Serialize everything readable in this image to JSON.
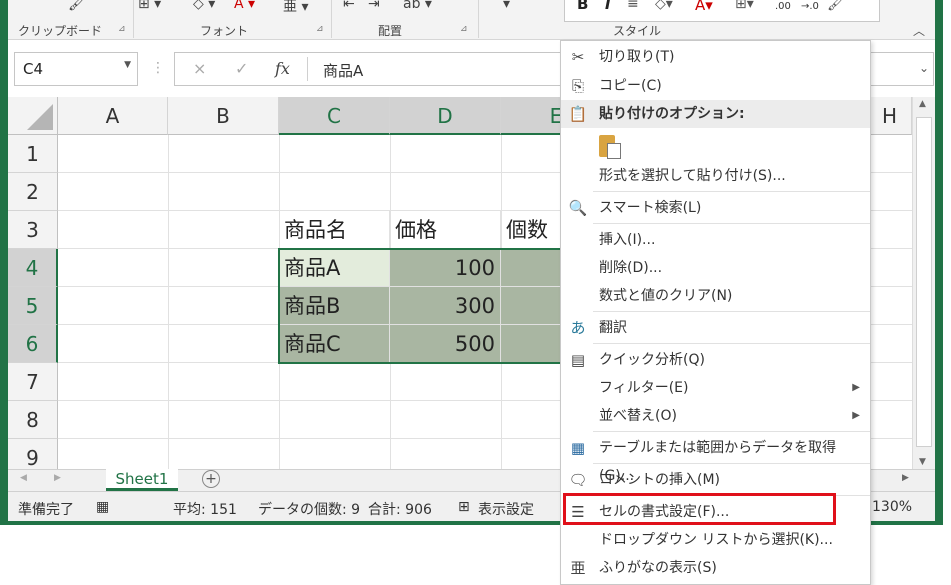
{
  "ribbon": {
    "groups": [
      "クリップボード",
      "フォント",
      "配置",
      "スタイル"
    ]
  },
  "formula_bar": {
    "name_box": "C4",
    "fx_label": "fx",
    "cancel_icon": "×",
    "confirm_icon": "✓",
    "value": "商品A"
  },
  "columns": [
    "A",
    "B",
    "C",
    "D",
    "E",
    "H"
  ],
  "rows": [
    "1",
    "2",
    "3",
    "4",
    "5",
    "6",
    "7",
    "8",
    "9"
  ],
  "cells": {
    "C3": "商品名",
    "D3": "価格",
    "E3": "個数",
    "C4": "商品A",
    "D4": "100",
    "C5": "商品B",
    "D5": "300",
    "C6": "商品C",
    "D6": "500"
  },
  "sheet_tab": "Sheet1",
  "add_sheet": "+",
  "status": {
    "ready": "準備完了",
    "average": "平均: 151",
    "count": "データの個数: 9",
    "sum": "合計: 906",
    "display_settings": "表示設定",
    "zoom": "130%"
  },
  "context_menu": {
    "items": [
      {
        "label": "切り取り(T)",
        "icon": "scissors-icon"
      },
      {
        "label": "コピー(C)",
        "icon": "copy-icon"
      },
      {
        "label": "貼り付けのオプション:",
        "icon": "clipboard-icon"
      },
      {
        "label": "形式を選択して貼り付け(S)..."
      },
      {
        "label": "スマート検索(L)",
        "icon": "search-icon"
      },
      {
        "label": "挿入(I)..."
      },
      {
        "label": "削除(D)..."
      },
      {
        "label": "数式と値のクリア(N)"
      },
      {
        "label": "翻訳",
        "icon": "translate-icon"
      },
      {
        "label": "クイック分析(Q)",
        "icon": "quick-analysis-icon"
      },
      {
        "label": "フィルター(E)"
      },
      {
        "label": "並べ替え(O)"
      },
      {
        "label": "テーブルまたは範囲からデータを取得(G)...",
        "icon": "table-icon"
      },
      {
        "label": "コメントの挿入(M)",
        "icon": "comment-icon"
      },
      {
        "label": "セルの書式設定(F)...",
        "icon": "format-cells-icon"
      },
      {
        "label": "ドロップダウン リストから選択(K)..."
      },
      {
        "label": "ふりがなの表示(S)",
        "icon": "furigana-icon"
      }
    ]
  },
  "mini_toolbar": {
    "bold": "B",
    "italic": "I",
    "style_label": "スタイル",
    "decimal_inc": ".00",
    "decimal_dec": "→.0"
  },
  "colors": {
    "excel_green": "#217346",
    "highlight": "#e0101a",
    "selection_fill": "#a9b6a2"
  }
}
